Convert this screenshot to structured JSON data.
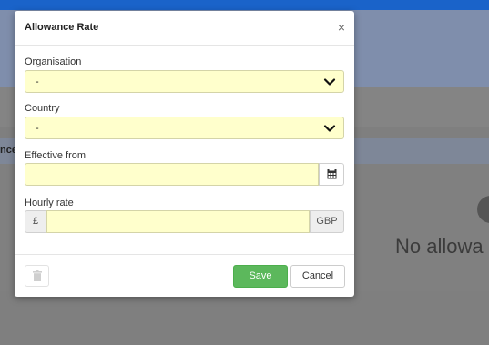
{
  "background": {
    "tab_text": "nces",
    "empty_text": "No allowa"
  },
  "modal": {
    "title": "Allowance Rate",
    "close_icon": "×",
    "organisation": {
      "label": "Organisation",
      "value": "-"
    },
    "country": {
      "label": "Country",
      "value": "-"
    },
    "effective_from": {
      "label": "Effective from",
      "value": ""
    },
    "hourly_rate": {
      "label": "Hourly rate",
      "prefix": "£",
      "suffix": "GBP",
      "value": ""
    },
    "save_label": "Save",
    "cancel_label": "Cancel"
  },
  "colors": {
    "input_bg": "#ffffcc",
    "save_green": "#5cb85c",
    "topbar_blue": "#1a63c9"
  },
  "icons": {
    "select": "chevron-down-icon",
    "date": "calendar-icon",
    "delete": "trash-icon",
    "close": "close-icon"
  }
}
